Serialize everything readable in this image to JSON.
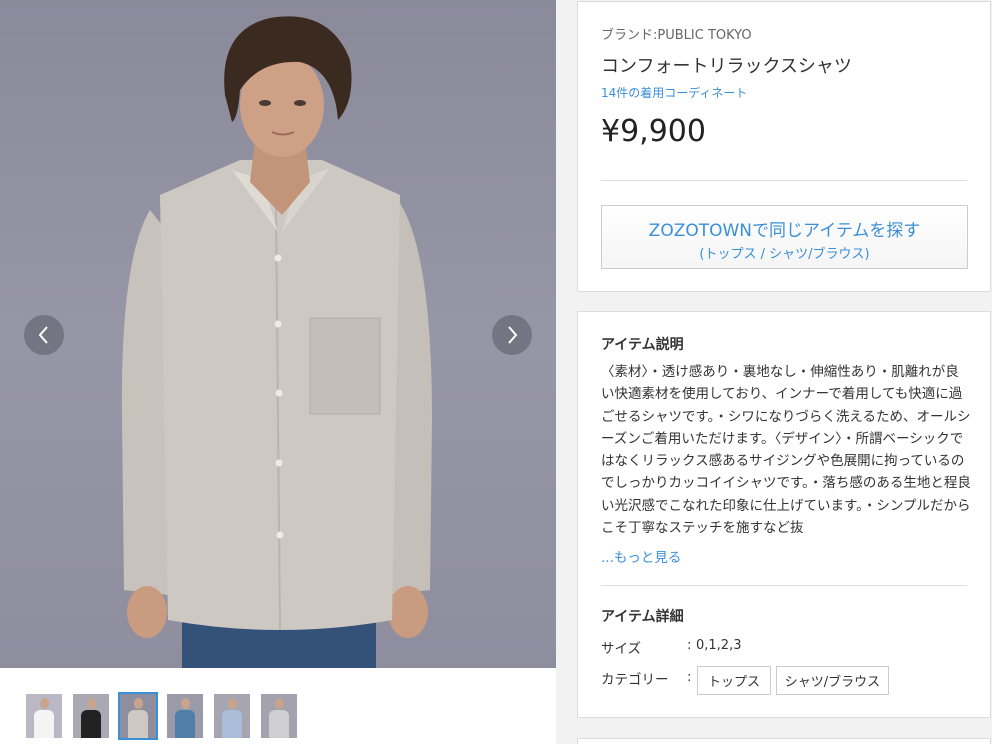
{
  "product": {
    "brand": "ブランド:PUBLIC TOKYO",
    "title": "コンフォートリラックスシャツ",
    "coordinate_link": "14件の着用コーディネート",
    "price": "¥9,900"
  },
  "zozo_button": {
    "main": "ZOZOTOWNで同じアイテムを探す",
    "sub": "(トップス / シャツ/ブラウス)"
  },
  "description": {
    "title": "アイテム説明",
    "text": "〈素材〉・透け感あり・裏地なし・伸縮性あり・肌離れが良い快適素材を使用しており、インナーで着用しても快適に過ごせるシャツです。・シワになりづらく洗えるため、オールシーズンご着用いただけます。〈デザイン〉・所謂ベーシックではなくリラックス感あるサイジングや色展開に拘っているのでしっかりカッコイイシャツです。・落ち感のある生地と程良い光沢感でこなれた印象に仕上げています。・シンプルだからこそ丁寧なステッチを施すなど抜",
    "more": "...もっと見る"
  },
  "details": {
    "title": "アイテム詳細",
    "size_label": "サイズ",
    "size_value": "0,1,2,3",
    "category_label": "カテゴリー",
    "colon": ":",
    "categories": [
      "トップス",
      "シャツ/ブラウス"
    ]
  },
  "gallery": {
    "thumbnails": [
      {
        "name": "white",
        "bg": "#b9b8c4",
        "shirt": "#f4f4f4",
        "active": false
      },
      {
        "name": "black",
        "bg": "#a9a8b3",
        "shirt": "#222222",
        "active": false
      },
      {
        "name": "greige",
        "bg": "#8f8e9f",
        "shirt": "#cdc8c2",
        "active": true
      },
      {
        "name": "blue",
        "bg": "#9b9aa8",
        "shirt": "#4f7fa8",
        "active": false
      },
      {
        "name": "light-blue",
        "bg": "#a6a5b2",
        "shirt": "#a9bdd8",
        "active": false
      },
      {
        "name": "grey",
        "bg": "#a3a2ae",
        "shirt": "#cfcfd2",
        "active": false
      }
    ]
  },
  "colors": {
    "link": "#3a8fd9",
    "active_thumb_border": "#3a8fd9"
  }
}
